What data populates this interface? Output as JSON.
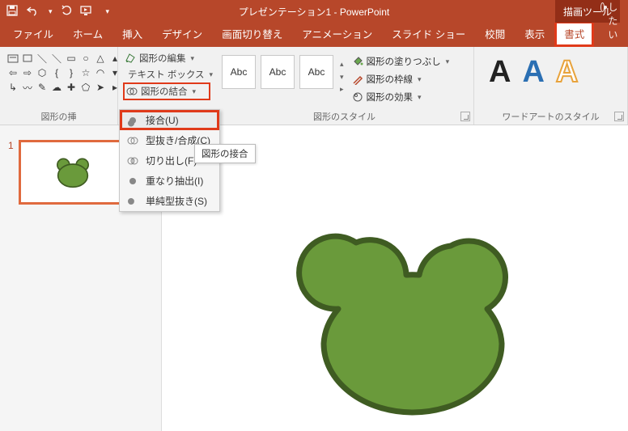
{
  "title": "プレゼンテーション1 - PowerPoint",
  "tool_context_tab": "描画ツール",
  "tabs": {
    "file": "ファイル",
    "home": "ホーム",
    "insert": "挿入",
    "design": "デザイン",
    "transitions": "画面切り替え",
    "animations": "アニメーション",
    "slideshow": "スライド ショー",
    "review": "校閲",
    "view": "表示",
    "format": "書式"
  },
  "tell_me": "実行したい",
  "ribbon": {
    "insert_shapes_group": "図形の挿",
    "shape_edit": "図形の編集",
    "text_box": "テキスト ボックス",
    "merge_shapes": "図形の結合",
    "shape_styles_group": "図形のスタイル",
    "abc": "Abc",
    "shape_fill": "図形の塗りつぶし",
    "shape_outline": "図形の枠線",
    "shape_effects": "図形の効果",
    "wordart_group": "ワードアートのスタイル"
  },
  "dropdown": {
    "union": "接合(U)",
    "combine": "型抜き/合成(C)",
    "fragment": "切り出し(F)",
    "intersect": "重なり抽出(I)",
    "subtract": "単純型抜き(S)"
  },
  "tooltip": "図形の接合",
  "slide_number": "1",
  "frog_color": "#6a9a3b",
  "frog_stroke": "#3f5c22"
}
